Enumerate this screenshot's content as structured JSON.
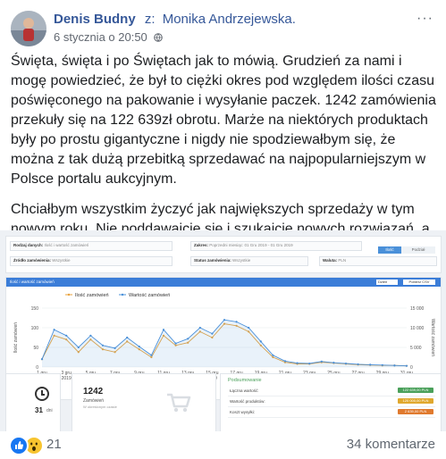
{
  "header": {
    "author": "Denis Budny",
    "separator": "z:",
    "target": "Monika Andrzejewska.",
    "timestamp": "6 stycznia o 20:50",
    "more": "···"
  },
  "post": {
    "paragraph1": "Święta, święta i po Świętach jak to mówią. Grudzień za nami i mogę powiedzieć, że był to ciężki okres pod względem ilości czasu poświęconego na pakowanie i wysyłanie paczek. 1242 zamówienia przekuły się na 122 639zł obrotu. Marże na niektórych produktach były po prostu gigantyczne i nigdy nie spodziewałbym się, że można z tak dużą przebitką sprzedawać na najpopularniejszym w Polsce portalu aukcyjnym.",
    "paragraph2": "Chciałbym wszystkim życzyć jak największych sprzedaży w tym nowym roku. Nie poddawajcie się i szukajcie nowych rozwiązań, a na pewno odniesiecie sukces!",
    "emoji": "smiling-face-icon"
  },
  "embedded": {
    "filters": {
      "data_type_label": "Rodzaj danych:",
      "data_type_value": "Ilość i wartość zamówień",
      "range_label": "Zakres:",
      "range_value": "Poprzedni miesiąc: 01 Gru 2019 - 01 Gru 2019",
      "scope_active": "Ilość",
      "scope_other": "Podział",
      "source_label": "Źródło zamówienia:",
      "source_value": "Wszystkie",
      "status_label": "Status zamówienia:",
      "status_value": "Wszystkie",
      "currency_label": "Waluta:",
      "currency_value": "PLN"
    },
    "chart_header": "Ilość i wartość zamówień",
    "chart_controls": {
      "group": "Dzień",
      "print": "Pobierz CSV"
    },
    "summary": {
      "title": "Podsumowanie",
      "rows": [
        {
          "label": "Łączna wartość:",
          "value": "122 639,00 PLN",
          "color": "#4aa05a"
        },
        {
          "label": "Wartość produktów:",
          "value": "120 000,00 PLN",
          "color": "#e0a82e"
        },
        {
          "label": "Koszt wysyłki:",
          "value": "2 639,00 PLN",
          "color": "#e07a2e"
        }
      ]
    },
    "days": {
      "value": "31",
      "unit": "dni"
    },
    "orders": {
      "value": "1242",
      "label": "Zamówień",
      "sub": "W określonym czasie"
    }
  },
  "chart_data": {
    "type": "line",
    "categories": [
      "1 gru\n2019",
      "3 gru\n2019",
      "5 gru\n2019",
      "7 gru\n2019",
      "9 gru\n2019",
      "11 gru\n2019",
      "13 gru\n2019",
      "15 gru\n2019",
      "17 gru\n2019",
      "19 gru\n2019",
      "21 gru\n2019",
      "23 gru\n2019",
      "25 gru\n2019",
      "27 gru\n2019",
      "29 gru\n2019",
      "31 gru\n2019"
    ],
    "x_ticks": [
      "1 gru",
      "3 gru",
      "5 gru",
      "7 gru",
      "9 gru",
      "11 gru",
      "13 gru",
      "15 gru",
      "17 gru",
      "19 gru",
      "21 gru",
      "23 gru",
      "25 gru",
      "27 gru",
      "29 gru",
      "31 gru"
    ],
    "x_tick_year": "2019",
    "series": [
      {
        "name": "Ilość zamówień",
        "color": "#e8a33d",
        "axis": "left",
        "values": [
          20,
          80,
          70,
          38,
          70,
          45,
          38,
          65,
          45,
          25,
          80,
          55,
          62,
          90,
          75,
          110,
          105,
          90,
          55,
          25,
          12,
          8,
          8,
          12,
          10,
          8,
          6,
          5,
          4,
          4,
          3
        ]
      },
      {
        "name": "Wartość zamówień",
        "color": "#4a90d9",
        "axis": "right",
        "values": [
          2000,
          9500,
          8000,
          5000,
          8000,
          5500,
          4800,
          7500,
          5200,
          3000,
          9500,
          6000,
          7200,
          10000,
          8500,
          12000,
          11500,
          10000,
          6500,
          3000,
          1500,
          1000,
          900,
          1400,
          1100,
          900,
          700,
          600,
          500,
          400,
          300
        ]
      }
    ],
    "ylabel_left": "Ilość zamówień",
    "ylabel_right": "Wartość zamówień",
    "ylim_left": [
      0,
      150
    ],
    "ylim_right": [
      0,
      15000
    ],
    "yticks_left": [
      "0",
      "50",
      "100",
      "150"
    ],
    "yticks_right": [
      "0",
      "5 000",
      "10 000",
      "15 000"
    ],
    "legend": "top-left",
    "grid": true
  },
  "footer": {
    "reactions": [
      "like-icon",
      "wow-icon"
    ],
    "reaction_count": "21",
    "comments": "34 komentarze"
  }
}
